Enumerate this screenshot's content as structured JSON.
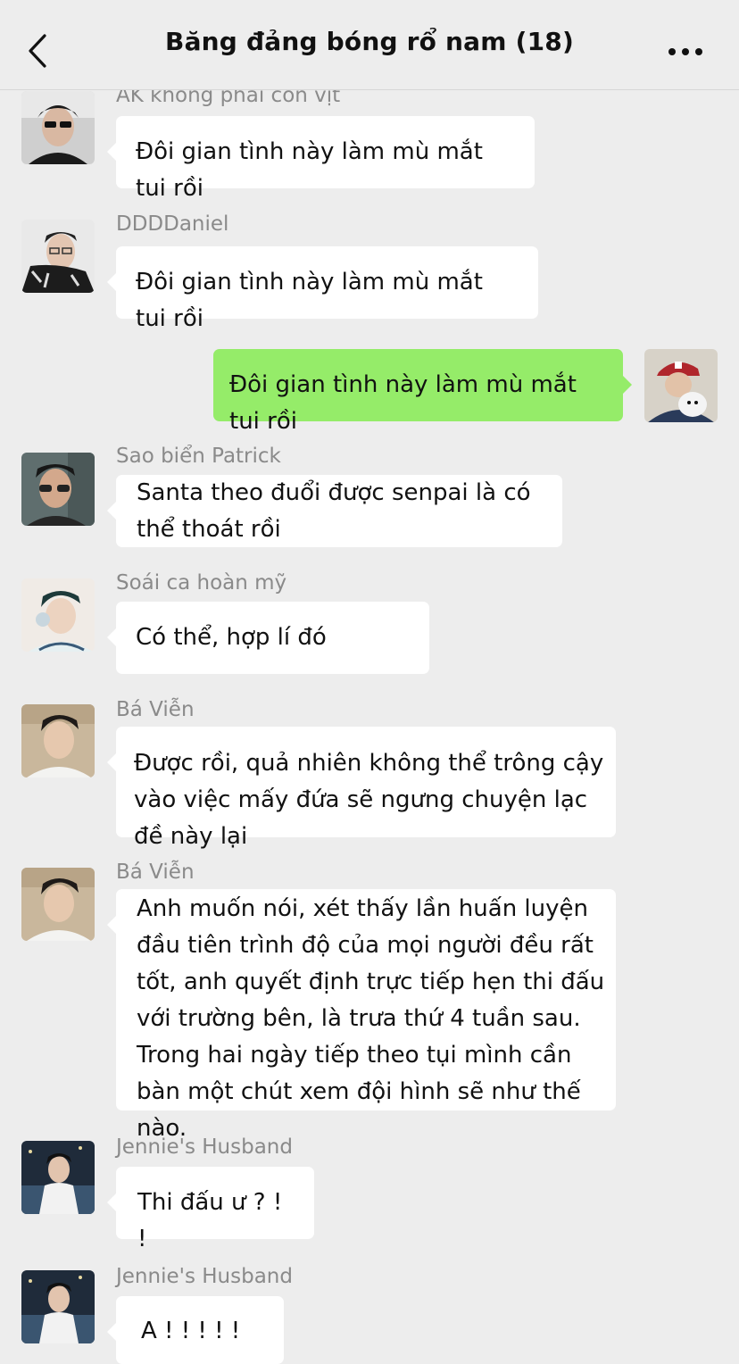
{
  "header": {
    "title": "Băng đảng bóng rổ nam (18)",
    "back_icon": "chevron-left-icon",
    "more_icon": "more-dots-icon"
  },
  "colors": {
    "background": "#ededed",
    "bubble_incoming": "#ffffff",
    "bubble_outgoing": "#95ec69",
    "sender_name": "#8a8a8a"
  },
  "messages": [
    {
      "sender": "AK không phải con vịt",
      "text": "Đôi gian tình này làm mù mắt tui rồi",
      "outgoing": false
    },
    {
      "sender": "DDDDaniel",
      "text": "Đôi gian tình này làm mù mắt tui rồi",
      "outgoing": false
    },
    {
      "sender": "",
      "text": "Đôi gian tình này làm mù mắt tui rồi",
      "outgoing": true
    },
    {
      "sender": "Sao biển Patrick",
      "text": "Santa theo đuổi được senpai là có thể thoát rồi",
      "outgoing": false
    },
    {
      "sender": "Soái ca hoàn mỹ",
      "text": "Có thể, hợp lí đó",
      "outgoing": false
    },
    {
      "sender": "Bá Viễn",
      "text": "Được rồi, quả nhiên không thể trông cậy vào việc mấy đứa sẽ ngưng chuyện lạc đề này lại",
      "outgoing": false
    },
    {
      "sender": "Bá Viễn",
      "text": "Anh muốn nói, xét thấy lần huấn luyện đầu tiên trình độ của mọi người đều rất tốt, anh quyết định trực tiếp hẹn thi đấu với trường bên, là trưa thứ 4 tuần sau. Trong hai ngày tiếp theo tụi mình cần bàn một chút xem đội hình sẽ như thế nào.",
      "outgoing": false
    },
    {
      "sender": "Jennie's Husband",
      "text": "Thi đấu ư ? ! !",
      "outgoing": false
    },
    {
      "sender": "Jennie's Husband",
      "text": "A ! ! ! ! !",
      "outgoing": false
    }
  ]
}
